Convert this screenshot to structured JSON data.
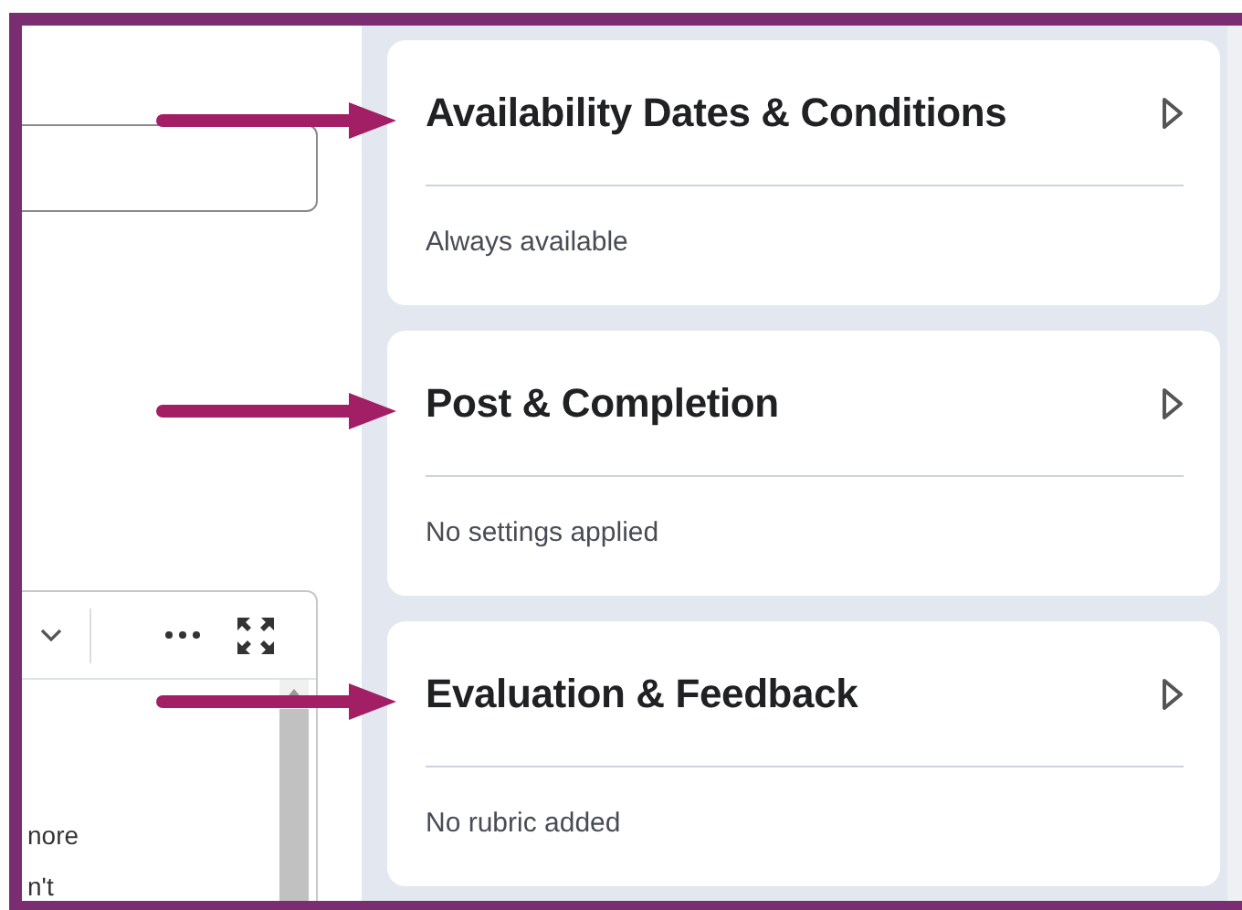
{
  "editor": {
    "text_lines": [
      "nore",
      "n't"
    ]
  },
  "cards": [
    {
      "title": "Availability Dates & Conditions",
      "summary": "Always available",
      "expanded": false,
      "pointed_at": true
    },
    {
      "title": "Post & Completion",
      "summary": "No settings applied",
      "expanded": false,
      "pointed_at": true
    },
    {
      "title": "Evaluation & Feedback",
      "summary": "No rubric added",
      "expanded": false,
      "pointed_at": true
    }
  ]
}
